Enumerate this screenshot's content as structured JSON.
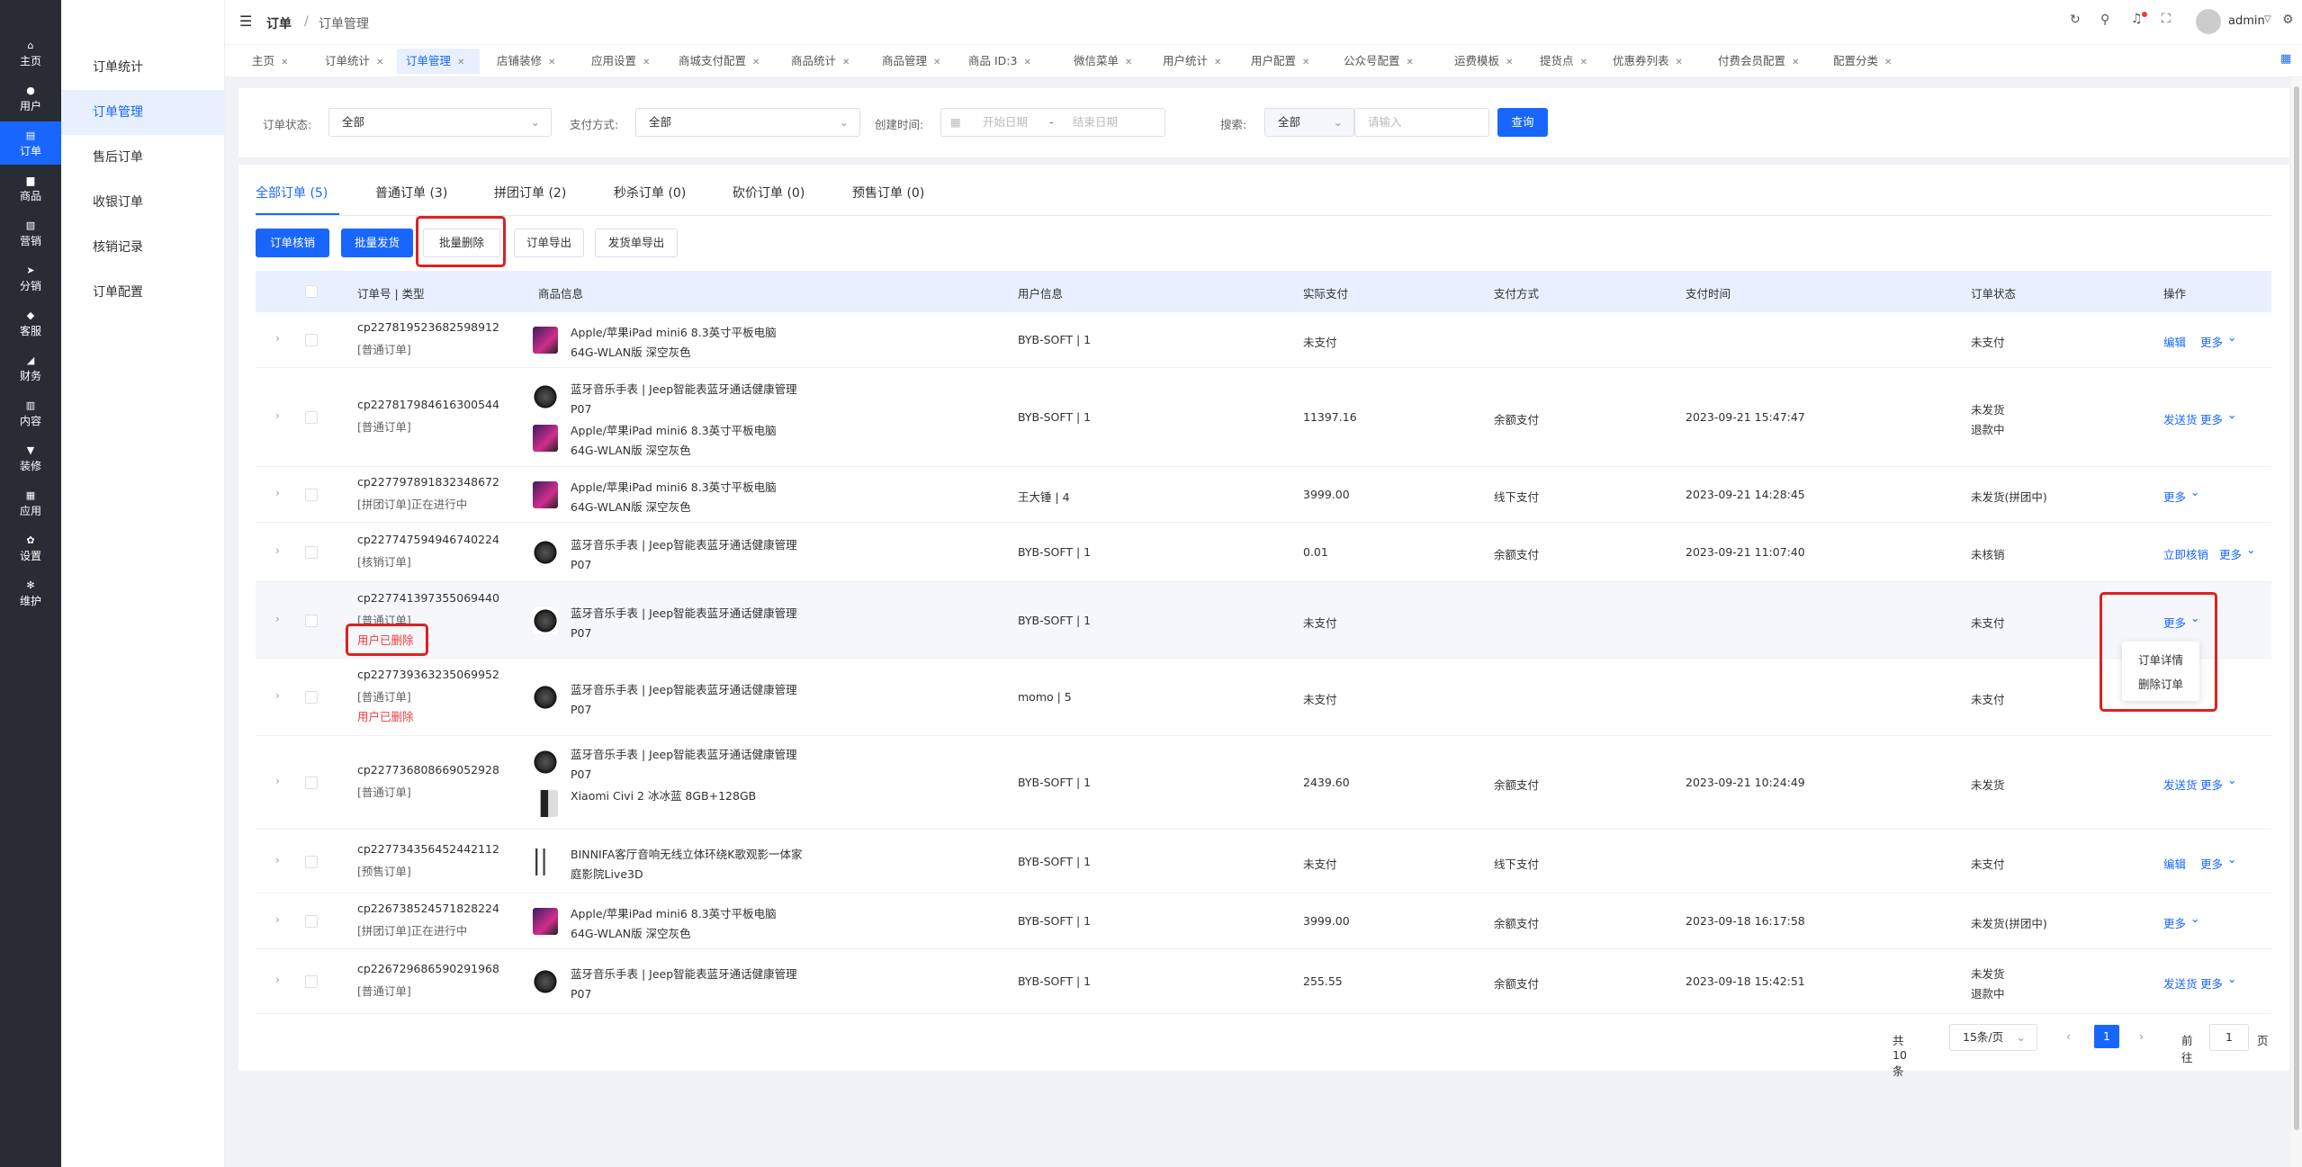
{
  "sidebar": {
    "items": [
      {
        "label": "主页",
        "icon": "home-icon",
        "glyph": "⌂"
      },
      {
        "label": "用户",
        "icon": "user-icon",
        "glyph": "●"
      },
      {
        "label": "订单",
        "icon": "order-icon",
        "glyph": "▤"
      },
      {
        "label": "商品",
        "icon": "product-icon",
        "glyph": "▆"
      },
      {
        "label": "营销",
        "icon": "marketing-icon",
        "glyph": "▧"
      },
      {
        "label": "分销",
        "icon": "distribution-icon",
        "glyph": "➤"
      },
      {
        "label": "客服",
        "icon": "service-icon",
        "glyph": "◆"
      },
      {
        "label": "财务",
        "icon": "finance-icon",
        "glyph": "◢"
      },
      {
        "label": "内容",
        "icon": "content-icon",
        "glyph": "▥"
      },
      {
        "label": "装修",
        "icon": "decorate-icon",
        "glyph": "▼"
      },
      {
        "label": "应用",
        "icon": "apps-icon",
        "glyph": "▦"
      },
      {
        "label": "设置",
        "icon": "settings-icon",
        "glyph": "✿"
      },
      {
        "label": "维护",
        "icon": "maintain-icon",
        "glyph": "✻"
      }
    ]
  },
  "submenu": {
    "items": [
      "订单统计",
      "订单管理",
      "售后订单",
      "收银订单",
      "核销记录",
      "订单配置"
    ]
  },
  "header": {
    "breadcrumb_root": "订单",
    "breadcrumb_sep": "/",
    "breadcrumb_current": "订单管理",
    "user": "admin"
  },
  "tabs": [
    "主页",
    "订单统计",
    "订单管理",
    "店铺装修",
    "应用设置",
    "商城支付配置",
    "商品统计",
    "商品管理",
    "商品 ID:3",
    "微信菜单",
    "用户统计",
    "用户配置",
    "公众号配置",
    "运费模板",
    "提货点",
    "优惠券列表",
    "付费会员配置",
    "配置分类"
  ],
  "filters": {
    "status_label": "订单状态:",
    "status_value": "全部",
    "pay_label": "支付方式:",
    "pay_value": "全部",
    "time_label": "创建时间:",
    "start_placeholder": "开始日期",
    "range_sep": "-",
    "end_placeholder": "结束日期",
    "search_label": "搜索:",
    "search_type": "全部",
    "search_placeholder": "请输入",
    "query_btn": "查询"
  },
  "order_tabs": [
    "全部订单 (5)",
    "普通订单 (3)",
    "拼团订单 (2)",
    "秒杀订单 (0)",
    "砍价订单 (0)",
    "预售订单 (0)"
  ],
  "actions": [
    "订单核销",
    "批量发货",
    "批量删除",
    "订单导出",
    "发货单导出"
  ],
  "columns": [
    "订单号 | 类型",
    "商品信息",
    "用户信息",
    "实际支付",
    "支付方式",
    "支付时间",
    "订单状态",
    "操作"
  ],
  "rows": [
    {
      "id": "cp227819523682598912",
      "type": "[普通订单]",
      "deleted": "",
      "products": [
        {
          "img": "ipad",
          "name": "Apple/苹果iPad mini6 8.3英寸平板电脑 64G-WLAN版 深空灰色"
        }
      ],
      "user": "BYB-SOFT | 1",
      "amount": "未支付",
      "method": "",
      "time": "",
      "status": [
        "未支付"
      ],
      "ops": [
        "编辑",
        "更多"
      ]
    },
    {
      "id": "cp227817984616300544",
      "type": "[普通订单]",
      "deleted": "",
      "products": [
        {
          "img": "watch",
          "name": "蓝牙音乐手表 | Jeep智能表蓝牙通话健康管理P07"
        },
        {
          "img": "ipad",
          "name": "Apple/苹果iPad mini6 8.3英寸平板电脑 64G-WLAN版 深空灰色"
        }
      ],
      "user": "BYB-SOFT | 1",
      "amount": "11397.16",
      "method": "余额支付",
      "time": "2023-09-21 15:47:47",
      "status": [
        "未发货",
        "退款中"
      ],
      "ops": [
        "发送货",
        "更多"
      ]
    },
    {
      "id": "cp227797891832348672",
      "type": "[拼团订单]正在进行中",
      "deleted": "",
      "products": [
        {
          "img": "ipad",
          "name": "Apple/苹果iPad mini6 8.3英寸平板电脑 64G-WLAN版 深空灰色"
        }
      ],
      "user": "王大锤 | 4",
      "amount": "3999.00",
      "method": "线下支付",
      "time": "2023-09-21 14:28:45",
      "status": [
        "未发货(拼团中)"
      ],
      "ops": [
        "更多"
      ]
    },
    {
      "id": "cp227747594946740224",
      "type": "[核销订单]",
      "deleted": "",
      "products": [
        {
          "img": "watch",
          "name": "蓝牙音乐手表 | Jeep智能表蓝牙通话健康管理P07"
        }
      ],
      "user": "BYB-SOFT | 1",
      "amount": "0.01",
      "method": "余额支付",
      "time": "2023-09-21 11:07:40",
      "status": [
        "未核销"
      ],
      "ops": [
        "立即核销",
        "更多"
      ]
    },
    {
      "id": "cp227741397355069440",
      "type": "[普通订单]",
      "deleted": "用户已删除",
      "products": [
        {
          "img": "watch",
          "name": "蓝牙音乐手表 | Jeep智能表蓝牙通话健康管理P07"
        }
      ],
      "user": "BYB-SOFT | 1",
      "amount": "未支付",
      "method": "",
      "time": "",
      "status": [
        "未支付"
      ],
      "ops": [
        "更多"
      ]
    },
    {
      "id": "cp227739363235069952",
      "type": "[普通订单]",
      "deleted": "用户已删除",
      "products": [
        {
          "img": "watch",
          "name": "蓝牙音乐手表 | Jeep智能表蓝牙通话健康管理P07"
        }
      ],
      "user": "momo | 5",
      "amount": "未支付",
      "method": "",
      "time": "",
      "status": [
        "未支付"
      ],
      "ops": []
    },
    {
      "id": "cp227736808669052928",
      "type": "[普通订单]",
      "deleted": "",
      "products": [
        {
          "img": "watch",
          "name": "蓝牙音乐手表 | Jeep智能表蓝牙通话健康管理P07"
        },
        {
          "img": "phone",
          "name": "Xiaomi Civi 2 冰冰蓝 8GB+128GB"
        }
      ],
      "user": "BYB-SOFT | 1",
      "amount": "2439.60",
      "method": "余额支付",
      "time": "2023-09-21 10:24:49",
      "status": [
        "未发货"
      ],
      "ops": [
        "发送货",
        "更多"
      ]
    },
    {
      "id": "cp227734356452442112",
      "type": "[预售订单]",
      "deleted": "",
      "products": [
        {
          "img": "spk",
          "name": "BINNIFA客厅音响无线立体环绕K歌观影一体家庭影院Live3D"
        }
      ],
      "user": "BYB-SOFT | 1",
      "amount": "未支付",
      "method": "线下支付",
      "time": "",
      "status": [
        "未支付"
      ],
      "ops": [
        "编辑",
        "更多"
      ]
    },
    {
      "id": "cp226738524571828224",
      "type": "[拼团订单]正在进行中",
      "deleted": "",
      "products": [
        {
          "img": "ipad",
          "name": "Apple/苹果iPad mini6 8.3英寸平板电脑 64G-WLAN版 深空灰色"
        }
      ],
      "user": "BYB-SOFT | 1",
      "amount": "3999.00",
      "method": "余额支付",
      "time": "2023-09-18 16:17:58",
      "status": [
        "未发货(拼团中)"
      ],
      "ops": [
        "更多"
      ]
    },
    {
      "id": "cp226729686590291968",
      "type": "[普通订单]",
      "deleted": "",
      "products": [
        {
          "img": "watch",
          "name": "蓝牙音乐手表 | Jeep智能表蓝牙通话健康管理P07"
        }
      ],
      "user": "BYB-SOFT | 1",
      "amount": "255.55",
      "method": "余额支付",
      "time": "2023-09-18 15:42:51",
      "status": [
        "未发货",
        "退款中"
      ],
      "ops": [
        "发送货",
        "更多"
      ]
    }
  ],
  "dropdown": [
    "订单详情",
    "删除订单"
  ],
  "pager": {
    "total": "共 10 条",
    "size": "15条/页",
    "current": "1",
    "goto": "前往",
    "goto_value": "1",
    "page_unit": "页"
  },
  "colors": {
    "primary": "#1966ff",
    "sidebar": "#282c34",
    "danger": "#f03a3a",
    "highlight": "#e02020"
  }
}
